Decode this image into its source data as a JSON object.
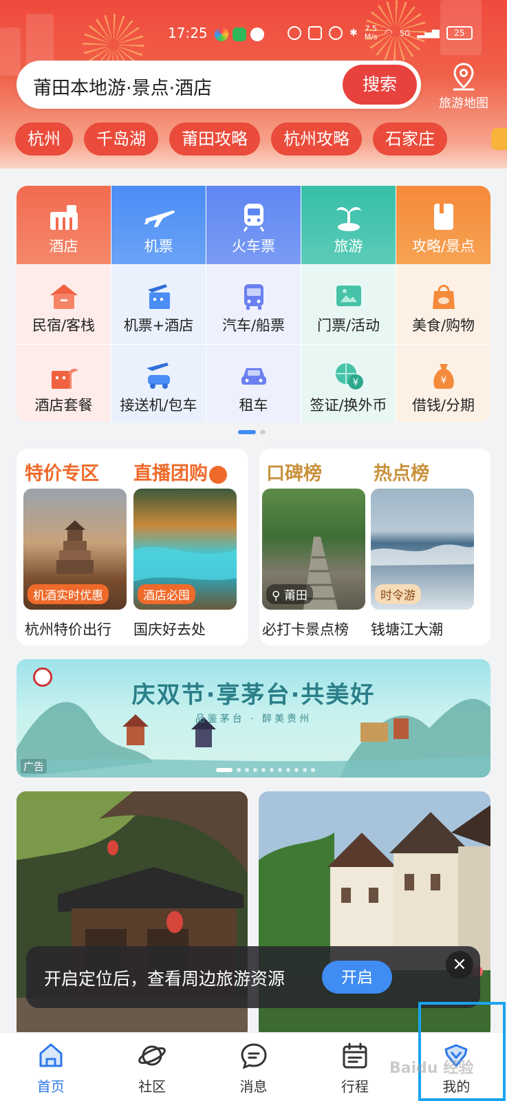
{
  "status_bar": {
    "time": "17:25",
    "network_speed_value": "7.5",
    "network_speed_unit": "M/s",
    "signal": "5G",
    "battery": "25"
  },
  "search": {
    "text": "莆田本地游·景点·酒店",
    "button_label": "搜索"
  },
  "map_button": {
    "label": "旅游地图"
  },
  "chips": [
    "杭州",
    "千岛湖",
    "莆田攻略",
    "杭州攻略",
    "石家庄"
  ],
  "categories": {
    "row1": [
      {
        "label": "酒店",
        "icon": "hotel-icon"
      },
      {
        "label": "机票",
        "icon": "plane-icon"
      },
      {
        "label": "火车票",
        "icon": "train-icon"
      },
      {
        "label": "旅游",
        "icon": "palm-tree-icon"
      },
      {
        "label": "攻略/景点",
        "icon": "guidebook-icon"
      }
    ],
    "row2": [
      {
        "label": "民宿/客栈",
        "icon": "house-icon"
      },
      {
        "label": "机票+酒店",
        "icon": "plane-hotel-icon"
      },
      {
        "label": "汽车/船票",
        "icon": "bus-icon"
      },
      {
        "label": "门票/活动",
        "icon": "ticket-icon"
      },
      {
        "label": "美食/购物",
        "icon": "shopping-bag-icon"
      }
    ],
    "row3": [
      {
        "label": "酒店套餐",
        "icon": "hotel-package-icon"
      },
      {
        "label": "接送机/包车",
        "icon": "airport-transfer-icon"
      },
      {
        "label": "租车",
        "icon": "car-icon"
      },
      {
        "label": "签证/换外币",
        "icon": "visa-currency-icon"
      },
      {
        "label": "借钱/分期",
        "icon": "money-bag-icon"
      }
    ]
  },
  "promo_left": {
    "heading_1": "特价专区",
    "heading_2": "直播团购",
    "items": [
      {
        "tag": "机酒实时优惠",
        "caption": "杭州特价出行"
      },
      {
        "tag": "酒店必囤",
        "caption": "国庆好去处"
      }
    ]
  },
  "promo_right": {
    "heading_1": "口碑榜",
    "heading_2": "热点榜",
    "items": [
      {
        "tag": "莆田",
        "caption": "必打卡景点榜"
      },
      {
        "tag": "时令游",
        "caption": "钱塘江大潮"
      }
    ]
  },
  "ad": {
    "title": "庆双节·享茅台·共美好",
    "subtitle": "品鉴茅台 · 醉美贵州",
    "label": "广告"
  },
  "toast": {
    "text": "开启定位后，查看周边旅游资源",
    "button_label": "开启",
    "close_label": "×"
  },
  "bottom_nav": [
    {
      "label": "首页",
      "icon": "home-icon"
    },
    {
      "label": "社区",
      "icon": "planet-icon"
    },
    {
      "label": "消息",
      "icon": "message-icon"
    },
    {
      "label": "行程",
      "icon": "calendar-icon"
    },
    {
      "label": "我的",
      "icon": "profile-icon"
    }
  ],
  "watermark": "Baidu 经验",
  "colors": {
    "brand_red": "#e8423e",
    "brand_blue": "#3f8cf2",
    "promo_orange": "#ef6a2a"
  }
}
